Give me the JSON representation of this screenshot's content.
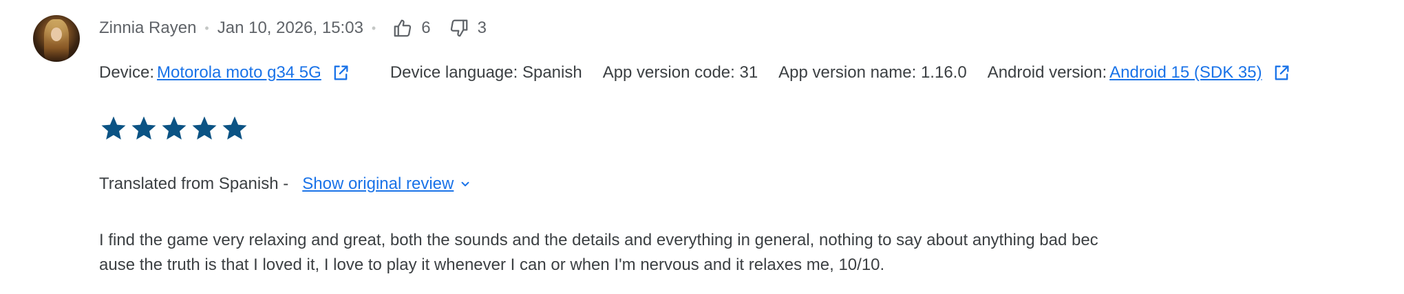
{
  "review": {
    "author": "Zinnia Rayen",
    "date": "Jan 10, 2026, 15:03",
    "thumbs_up_count": "6",
    "thumbs_down_count": "3",
    "rating": 5,
    "rating_max": 5
  },
  "device": {
    "device_label": "Device:",
    "device_name": "Motorola moto g34 5G",
    "language_label": "Device language: Spanish",
    "version_code_label": "App version code: 31",
    "version_name_label": "App version name: 1.16.0",
    "android_label": "Android version:",
    "android_version": "Android 15 (SDK 35)"
  },
  "translation": {
    "label": "Translated from Spanish -",
    "show_original": "Show original review"
  },
  "body": {
    "line1": "I find the game very relaxing and great, both the sounds and the details and everything in general, nothing to say about anything bad bec",
    "line2": "ause the truth is that I loved it, I love to play it whenever I can or when I'm nervous and it relaxes me, 10/10."
  },
  "colors": {
    "star": "#0b5384",
    "link": "#1a73e8",
    "text": "#3c4043",
    "muted": "#5f6368"
  },
  "icons": {
    "thumbs_up": "thumbs-up-icon",
    "thumbs_down": "thumbs-down-icon",
    "external": "open-in-new-icon",
    "chevron": "chevron-down-icon",
    "star": "star-icon"
  }
}
